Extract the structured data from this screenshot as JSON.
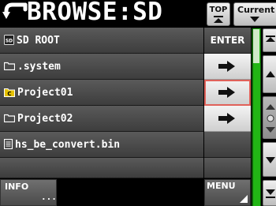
{
  "header": {
    "title": "BROWSE:SD",
    "back_icon": "back-arrow-icon",
    "top_button": "TOP",
    "current_button": "Current"
  },
  "root_row": {
    "label": "SD ROOT",
    "action": "ENTER",
    "icon": "sd-card-icon"
  },
  "items": [
    {
      "label": ".system",
      "icon": "folder-icon",
      "has_enter": true
    },
    {
      "label": "Project01",
      "icon": "current-project-folder-icon",
      "has_enter": true,
      "selected": true
    },
    {
      "label": "Project02",
      "icon": "folder-icon",
      "has_enter": true
    },
    {
      "label": "hs_be_convert.bin",
      "icon": "file-icon",
      "has_enter": false
    },
    {
      "label": "",
      "icon": "",
      "has_enter": false
    }
  ],
  "footer": {
    "info_label": "INFO",
    "info_more": "...",
    "menu_label": "MENU"
  },
  "colors": {
    "accent_green": "#22b515",
    "selection": "#e0625a",
    "current_project": "#e6c200"
  }
}
